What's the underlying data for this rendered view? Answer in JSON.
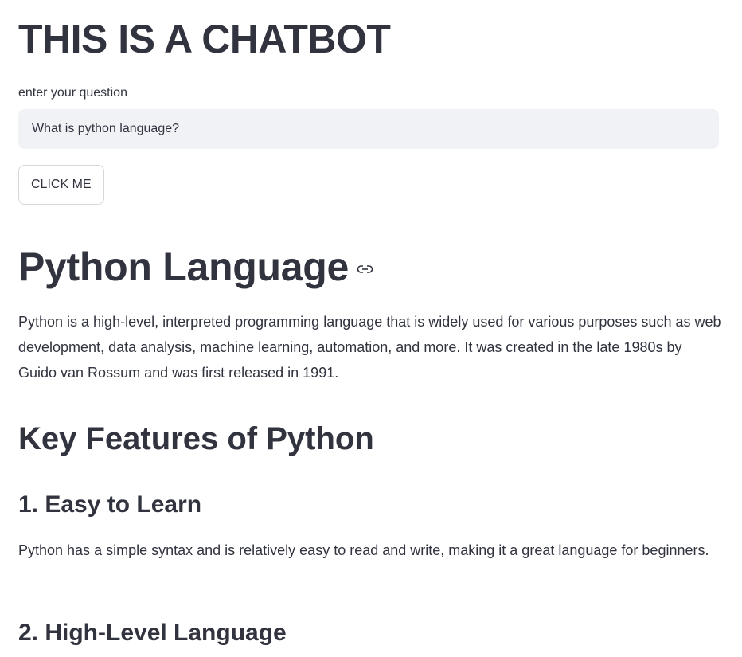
{
  "app": {
    "title": "THIS IS A CHATBOT"
  },
  "question": {
    "label": "enter your question",
    "value": "What is python language?"
  },
  "button": {
    "label": "CLICK ME"
  },
  "response": {
    "heading": "Python Language",
    "intro": "Python is a high-level, interpreted programming language that is widely used for various purposes such as web development, data analysis, machine learning, automation, and more. It was created in the late 1980s by Guido van Rossum and was first released in 1991.",
    "features_heading": "Key Features of Python",
    "features": [
      {
        "title": "1. Easy to Learn",
        "text": "Python has a simple syntax and is relatively easy to read and write, making it a great language for beginners."
      },
      {
        "title": "2. High-Level Language"
      }
    ]
  },
  "icons": {
    "anchor": "link-icon"
  },
  "colors": {
    "text": "#31333f",
    "input_bg": "#f0f2f6",
    "button_border": "#d6d7dc"
  }
}
